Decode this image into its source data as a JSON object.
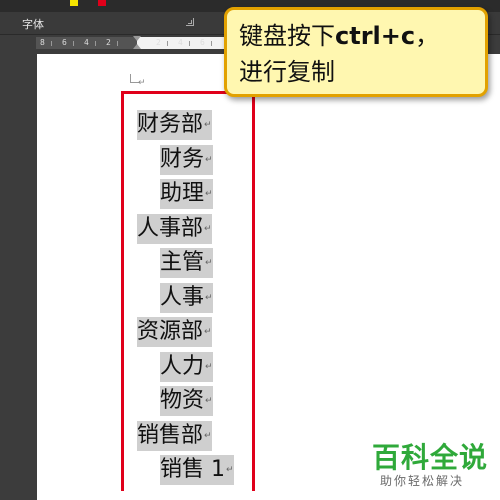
{
  "ribbon": {
    "group_label": "字体"
  },
  "ruler": {
    "numbers": [
      "8",
      "6",
      "4",
      "2",
      "2",
      "4",
      "6"
    ]
  },
  "document": {
    "lines": [
      {
        "text": "财务部",
        "indent": 0
      },
      {
        "text": "财务",
        "indent": 1
      },
      {
        "text": "助理",
        "indent": 1
      },
      {
        "text": "人事部",
        "indent": 0
      },
      {
        "text": "主管",
        "indent": 1
      },
      {
        "text": "人事",
        "indent": 1
      },
      {
        "text": "资源部",
        "indent": 0
      },
      {
        "text": "人力",
        "indent": 1
      },
      {
        "text": "物资",
        "indent": 1
      },
      {
        "text": "销售部",
        "indent": 0
      },
      {
        "text": "销售 1",
        "indent": 1
      }
    ],
    "paragraph_mark": "↵"
  },
  "callout": {
    "line1_prefix": "键盘按下",
    "line1_keys": "ctrl+c",
    "line1_suffix": "，",
    "line2": "进行复制"
  },
  "watermark": {
    "title": "百科全说",
    "subtitle": "助你轻松解决"
  },
  "colors": {
    "highlight_box": "#e0001a",
    "callout_border": "#e2a100",
    "callout_bg": "#fff7b0",
    "watermark": "#2fa93a"
  }
}
